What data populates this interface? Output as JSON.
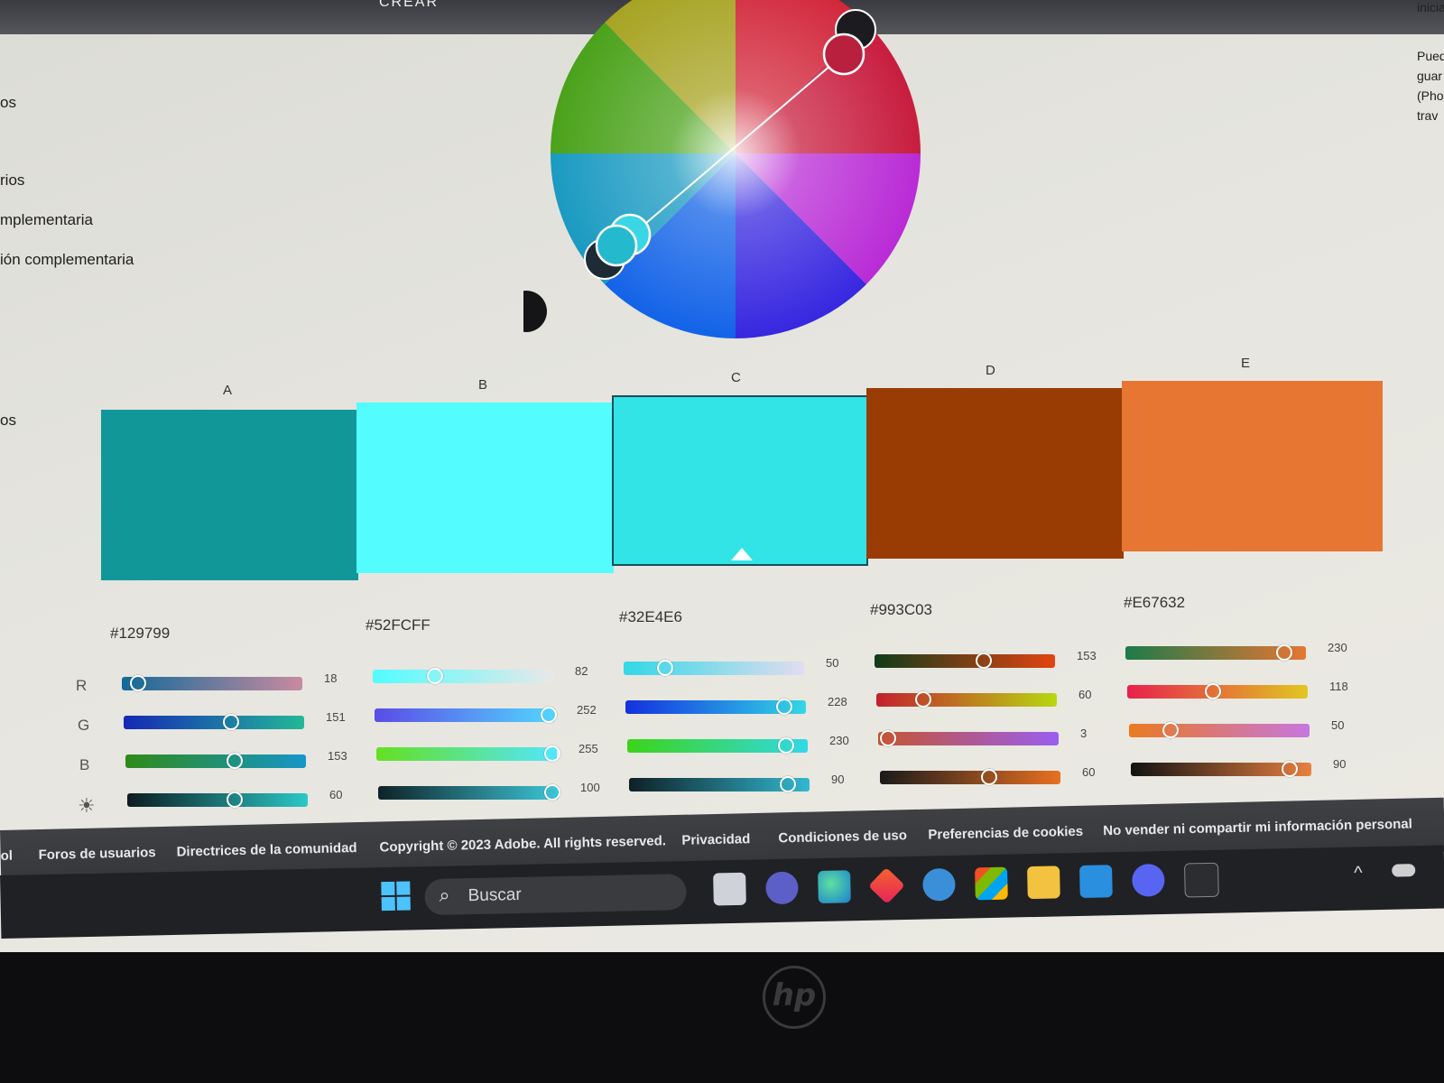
{
  "topbar": {
    "label": "CREAR"
  },
  "left_menu": [
    "os",
    "rios",
    "mplementaria",
    "ión complementaria",
    "os"
  ],
  "right_note": [
    "inicia",
    "Pued",
    "guar",
    "(Pho",
    "trav"
  ],
  "swatches": [
    {
      "letter": "A",
      "hex": "#129799",
      "color": "#129799",
      "sliders": [
        {
          "value": "18"
        },
        {
          "value": "151"
        },
        {
          "value": "153"
        },
        {
          "value": "60"
        }
      ]
    },
    {
      "letter": "B",
      "hex": "#52FCFF",
      "color": "#52FCFF",
      "sliders": [
        {
          "value": "82"
        },
        {
          "value": "252"
        },
        {
          "value": "255"
        },
        {
          "value": "100"
        }
      ]
    },
    {
      "letter": "C",
      "hex": "#32E4E6",
      "color": "#32E4E6",
      "sliders": [
        {
          "value": "50"
        },
        {
          "value": "228"
        },
        {
          "value": "230"
        },
        {
          "value": "90"
        }
      ]
    },
    {
      "letter": "D",
      "hex": "#993C03",
      "color": "#993C03",
      "sliders": [
        {
          "value": "153"
        },
        {
          "value": "60"
        },
        {
          "value": "3"
        },
        {
          "value": "60"
        }
      ]
    },
    {
      "letter": "E",
      "hex": "#E67632",
      "color": "#E67632",
      "sliders": [
        {
          "value": "230"
        },
        {
          "value": "118"
        },
        {
          "value": "50"
        },
        {
          "value": "90"
        }
      ]
    }
  ],
  "row_labels": [
    "R",
    "G",
    "B"
  ],
  "footer_links": [
    "ol",
    "Foros de usuarios",
    "Directrices de la comunidad",
    "Copyright © 2023 Adobe. All rights reserved.",
    "Privacidad",
    "Condiciones de uso",
    "Preferencias de cookies",
    "No vender ni compartir mi información personal"
  ],
  "taskbar": {
    "search_placeholder": "Buscar"
  },
  "bezel": {
    "logo": "hp"
  }
}
